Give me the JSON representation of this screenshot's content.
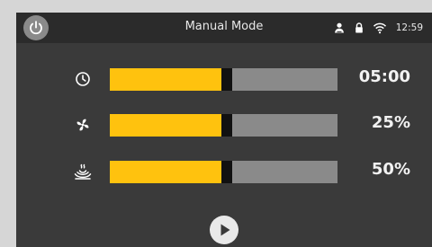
{
  "header": {
    "title": "Manual Mode",
    "time": "12:59",
    "icons": [
      "power-icon",
      "user-icon",
      "lock-icon",
      "wifi-icon"
    ]
  },
  "controls": [
    {
      "name": "timer",
      "icon": "clock-icon",
      "value_text": "05:00",
      "level": 0.5
    },
    {
      "name": "fan",
      "icon": "fan-icon",
      "value_text": "25%",
      "level": 0.5
    },
    {
      "name": "heat",
      "icon": "heat-waves-icon",
      "value_text": "50%",
      "level": 0.5
    }
  ],
  "footer": {
    "icon": "play-icon"
  },
  "colors": {
    "fill": "#ffc20e",
    "track": "#8a8a8a",
    "knob": "#111111",
    "background": "#3a3a3a",
    "statusbar": "#2b2b2b"
  }
}
